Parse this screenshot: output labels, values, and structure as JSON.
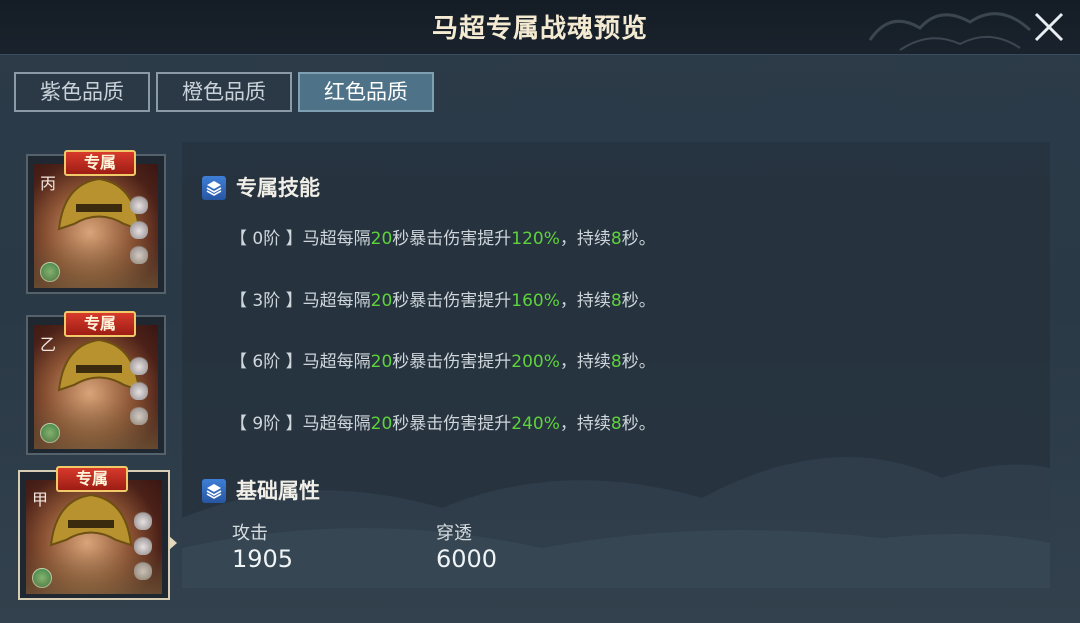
{
  "header": {
    "title": "马超专属战魂预览",
    "close_label": "close"
  },
  "tabs": [
    {
      "label": "紫色品质",
      "active": false
    },
    {
      "label": "橙色品质",
      "active": false
    },
    {
      "label": "红色品质",
      "active": true
    }
  ],
  "cards": [
    {
      "badge": "专属",
      "grade_char": "丙",
      "selected": false
    },
    {
      "badge": "专属",
      "grade_char": "乙",
      "selected": false
    },
    {
      "badge": "专属",
      "grade_char": "甲",
      "selected": true
    }
  ],
  "skill_section": {
    "title": "专属技能",
    "lines": [
      {
        "stage": "【 0阶 】",
        "hero": "马超每隔",
        "interval": "20",
        "mid": "秒暴击伤害提升",
        "percent": "120%",
        "dur_label": "，持续",
        "duration": "8",
        "end": "秒。"
      },
      {
        "stage": "【 3阶 】",
        "hero": "马超每隔",
        "interval": "20",
        "mid": "秒暴击伤害提升",
        "percent": "160%",
        "dur_label": "，持续",
        "duration": "8",
        "end": "秒。"
      },
      {
        "stage": "【 6阶 】",
        "hero": "马超每隔",
        "interval": "20",
        "mid": "秒暴击伤害提升",
        "percent": "200%",
        "dur_label": "，持续",
        "duration": "8",
        "end": "秒。"
      },
      {
        "stage": "【 9阶 】",
        "hero": "马超每隔",
        "interval": "20",
        "mid": "秒暴击伤害提升",
        "percent": "240%",
        "dur_label": "，持续",
        "duration": "8",
        "end": "秒。"
      }
    ]
  },
  "attr_section": {
    "title": "基础属性",
    "attack_label": "攻击",
    "attack_value": "1905",
    "pierce_label": "穿透",
    "pierce_value": "6000"
  },
  "colors": {
    "highlight": "#5ed23b",
    "active_tab": "#4e7388",
    "badge_red": "#c7291c"
  }
}
